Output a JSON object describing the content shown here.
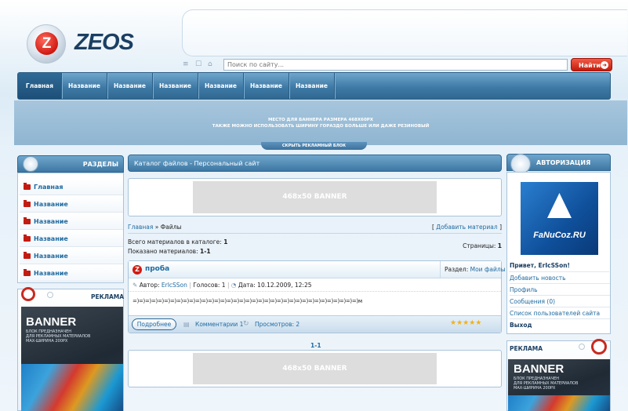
{
  "logo": {
    "letter": "Z",
    "text": "ZEOS"
  },
  "search": {
    "placeholder": "Поиск по сайту...",
    "button": "Найти",
    "tool_icons": [
      "rss-icon",
      "bookmark-icon",
      "home-icon"
    ]
  },
  "nav": {
    "items": [
      "Главная",
      "Название",
      "Название",
      "Название",
      "Название",
      "Название",
      "Название"
    ],
    "active_index": 0
  },
  "top_banner": {
    "line1": "МЕСТО ДЛЯ БАННЕРА РАЗМЕРА 468X60PX",
    "line2": "ТАКЖЕ МОЖНО ИСПОЛЬЗОВАТЬ ШИРИНУ ГОРАЗДО БОЛЬШЕ ИЛИ ДАЖЕ РЕЗИНОВЫЙ",
    "hide_label": "СКРЫТЬ РЕКЛАМНЫЙ БЛОК"
  },
  "sidebar_left": {
    "sections_title": "РАЗДЕЛЫ",
    "items": [
      {
        "label": "Главная"
      },
      {
        "label": "Название"
      },
      {
        "label": "Название"
      },
      {
        "label": "Название"
      },
      {
        "label": "Название"
      },
      {
        "label": "Название"
      }
    ],
    "ad_title": "РЕКЛАМА",
    "ad": {
      "title": "BANNER",
      "sub1": "БЛОК ПРЕДНАЗНАЧЕН",
      "sub2": "ДЛЯ РЕКЛАМНЫХ МАТЕРИАЛОВ",
      "sub3": "MAX-ШИРИНА 200PX"
    }
  },
  "main": {
    "header": "Каталог файлов - Персональный сайт",
    "banner_top": "468x50 BANNER",
    "breadcrumb": {
      "home": "Главная",
      "sep": " » ",
      "current": "Файлы"
    },
    "add_material": "Добавить материал",
    "bracket_open": "[ ",
    "bracket_close": " ]",
    "total_label": "Всего материалов в каталоге: ",
    "total_value": "1",
    "shown_label": "Показано материалов: ",
    "shown_value": "1-1",
    "pages_label": "Страницы: ",
    "pages_value": "1",
    "item": {
      "title": "проба",
      "section_label": "Раздел: ",
      "section_value": "Мои файлы",
      "author_label": "Автор: ",
      "author_value": "ErIcSSon",
      "votes": "Голосов: 1",
      "date": "Дата: 10.12.2009, 12:25",
      "body": "=)=)=)=)=)=)=)=)=)=)=)=)=)=)=)=)=)=)=)=)=)=)=)=)=)=)=)=)=)=)=)=)=)=)=)=)м",
      "more_button": "Подробнее",
      "comments": "Комментарии 1",
      "views": "Просмотров: 2",
      "rating_stars": 5
    },
    "pagination": "1-1",
    "banner_bottom": "468x50 BANNER"
  },
  "sidebar_right": {
    "auth_title": "АВТОРИЗАЦИЯ",
    "avatar_text": "FaNuCoz.RU",
    "greeting": "Привет, ErIcSSon!",
    "links": [
      "Добавить новость",
      "Профиль",
      "Сообщения (0)",
      "Список пользователей сайта"
    ],
    "logout": "Выход",
    "ad_title": "РЕКЛАМА",
    "ad": {
      "title": "BANNER",
      "sub1": "БЛОК ПРЕДНАЗНАЧЕН",
      "sub2": "ДЛЯ РЕКЛАМНЫХ МАТЕРИАЛОВ",
      "sub3": "MAX-ШИРИНА 200PX"
    }
  },
  "colors": {
    "accent": "#3d77a3",
    "red": "#c21b12",
    "link": "#1f6aa0"
  }
}
